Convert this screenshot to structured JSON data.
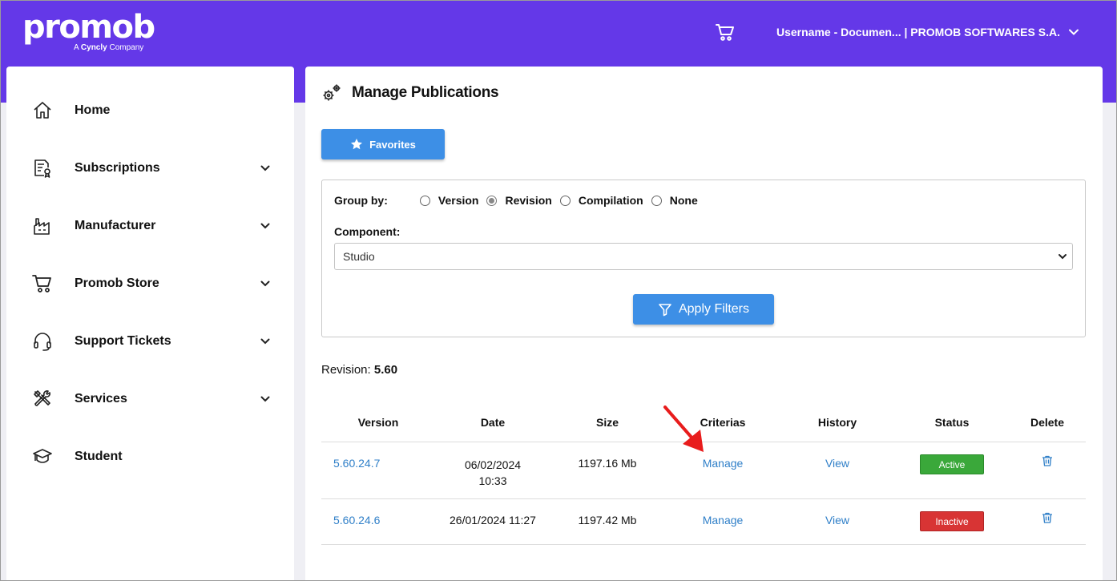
{
  "header": {
    "logo_text": "promob",
    "logo_sub_prefix": "A ",
    "logo_sub_brand": "Cyncly",
    "logo_sub_suffix": " Company",
    "user_menu_label": "Username - Documen... | PROMOB SOFTWARES S.A."
  },
  "sidebar": {
    "items": [
      {
        "label": "Home",
        "icon": "home-icon",
        "expandable": false
      },
      {
        "label": "Subscriptions",
        "icon": "subscription-certificate-icon",
        "expandable": true
      },
      {
        "label": "Manufacturer",
        "icon": "factory-icon",
        "expandable": true
      },
      {
        "label": "Promob Store",
        "icon": "cart-icon",
        "expandable": true
      },
      {
        "label": "Support Tickets",
        "icon": "headset-icon",
        "expandable": true
      },
      {
        "label": "Services",
        "icon": "tools-icon",
        "expandable": true
      },
      {
        "label": "Student",
        "icon": "graduation-cap-icon",
        "expandable": false
      }
    ]
  },
  "main": {
    "title": "Manage Publications",
    "favorites_label": "Favorites",
    "filters": {
      "group_by_label": "Group by:",
      "options": [
        "Version",
        "Revision",
        "Compilation",
        "None"
      ],
      "selected": "Revision",
      "component_label": "Component:",
      "component_value": "Studio",
      "apply_label": "Apply Filters"
    },
    "revision_label": "Revision:",
    "revision_value": "5.60",
    "table": {
      "headers": [
        "Version",
        "Date",
        "Size",
        "Criterias",
        "History",
        "Status",
        "Delete"
      ],
      "rows": [
        {
          "version": "5.60.24.7",
          "date_line1": "06/02/2024",
          "date_line2": "10:33",
          "size": "1197.16 Mb",
          "criterias": "Manage",
          "history": "View",
          "status": "Active"
        },
        {
          "version": "5.60.24.6",
          "date_line1": "26/01/2024 11:27",
          "date_line2": "",
          "size": "1197.42 Mb",
          "criterias": "Manage",
          "history": "View",
          "status": "Inactive"
        }
      ]
    }
  },
  "colors": {
    "brand_purple": "#6438e8",
    "primary_blue": "#3d8fe6",
    "link_blue": "#2f7fc8",
    "active_green": "#3aa83a",
    "inactive_red": "#d83434",
    "annotation_red": "#e81c1c"
  }
}
